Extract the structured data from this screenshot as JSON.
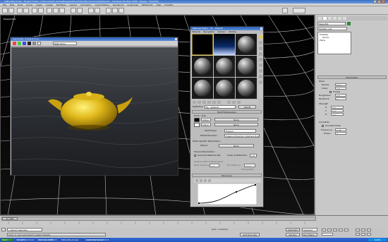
{
  "app": {
    "title": "C3Dunfile-0.max - Project Folder: C:\\Documents and Settings\\Administrator\\My Documents\\3dsmax - Autodesk 3ds Max 2008 - Display : Direct3D",
    "menu": [
      "File",
      "Edit",
      "Tools",
      "Group",
      "Views",
      "Create",
      "Modifiers",
      "reactor",
      "Animation",
      "Graph Editors",
      "Rendering",
      "Customize",
      "MAXScript",
      "Help",
      "FumeFX"
    ]
  },
  "viewport": {
    "label": "Perspective"
  },
  "render_window": {
    "title": "Camera01, frame 0 (1:1)",
    "channel": "RGB Alpha"
  },
  "material_editor": {
    "title": "Material Editor - 01 - Default",
    "menu": [
      "Material",
      "Navigation",
      "Options",
      "Utilities"
    ],
    "material_name": "01 - Default",
    "material_type": "Falloff",
    "falloff_params_title": "Falloff Parameters",
    "front_side": "Front : Side",
    "front_value": "100.0",
    "side_value": "100.0",
    "none_label": "None",
    "falloff_type_label": "Falloff Type:",
    "falloff_type_value": "Fresnel",
    "falloff_direction_label": "Falloff Direction:",
    "falloff_direction_value": "Viewing Direction (Camera Z-Axis)",
    "mode_specific_title": "Mode Specific Parameters:",
    "object_label": "Object:",
    "fresnel_title": "Fresnel Parameters:",
    "override_label": "Override Material IOR",
    "ior_label": "Index of Refraction",
    "ior_value": "1.6",
    "distance_blend_title": "Distance Blend Parameters:",
    "near_label": "Near Distance:",
    "near_value": "0.0",
    "far_label": "Far Distance:",
    "far_value": "100.0",
    "extrapolate_label": "Extrapolate",
    "mix_curve_title": "Mix Curve",
    "reflection_label": "Reflection"
  },
  "command_panel": {
    "object_name": "Teapot01",
    "modifier_list": "Modifier List",
    "stack": [
      "Editable",
      "Gizmo",
      "Plane"
    ],
    "params_title": "Parameters",
    "wave_title": "Wave",
    "radius_label": "Radius:",
    "radius_value": "50.0",
    "scale_label": "Scale:",
    "scale_value": "1.0",
    "fractal_label": "Fractal",
    "roughness_label": "Roughness:",
    "roughness_value": "0.5",
    "iterations_label": "Iterations:",
    "iterations_value": "6",
    "strength_title": "Strength",
    "x_label": "X:",
    "x_value": "0.0",
    "y_label": "Y:",
    "y_value": "0.0",
    "z_label": "Z:",
    "z_value": "2.0",
    "animation_title": "Animation",
    "animate_noise_label": "Animate Noise",
    "frequency_label": "Frequency:",
    "frequency_value": "0.25",
    "phase_label": "Phase:",
    "phase_value": "0"
  },
  "status": {
    "frame_counter": "0 / 100",
    "selected": "1 Object Selected",
    "prompt": "Click or click-and-drag to select objects",
    "grid": "Grid = 10.0mm",
    "auto_key": "Auto Key",
    "set_key": "Set Key",
    "selected_dropdown": "Selected",
    "key_filters": "Key Filters...",
    "time_tag": "Add Time Tag"
  },
  "taskbar": {
    "items": [
      "Start",
      "FumeFx",
      "3ds max 2008",
      "C3Dunfile-0.max",
      "Load Site Screen"
    ],
    "clock": "10:52"
  }
}
